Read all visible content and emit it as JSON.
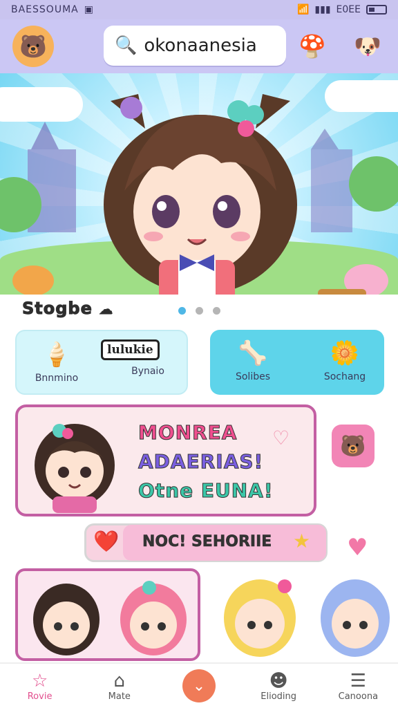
{
  "status": {
    "carrier": "BAESSOUMA",
    "battery_text": "E0EE"
  },
  "header": {
    "search_value": "okonaanesia"
  },
  "section": {
    "label": "Stogbe"
  },
  "cards": {
    "left": [
      {
        "label": "Bnnmino",
        "icon": "ice-cream-icon"
      },
      {
        "label": "Bynaio",
        "icon": "speech-bubble-icon"
      }
    ],
    "speech_text": "lulukie",
    "right": [
      {
        "label": "Solibes",
        "icon": "bone-icon"
      },
      {
        "label": "Sochang",
        "icon": "flower-icon"
      }
    ]
  },
  "promo": {
    "line1": "MONREA",
    "line2": "ADAERIAS!",
    "line3": "Otne EUNA!"
  },
  "pill": {
    "label": "NOC! SEHORIIE"
  },
  "nav": [
    {
      "label": "Rovie",
      "icon": "star-icon"
    },
    {
      "label": "Mate",
      "icon": "house-icon"
    },
    {
      "label": "",
      "icon": "chevron-down-icon"
    },
    {
      "label": "Elioding",
      "icon": "face-icon"
    },
    {
      "label": "Canoona",
      "icon": "bars-icon"
    }
  ],
  "colors": {
    "header_bg": "#cbc7f4",
    "accent_pink": "#c35fa3",
    "accent_cyan": "#5ed4ea",
    "nav_center": "#f07b58"
  }
}
